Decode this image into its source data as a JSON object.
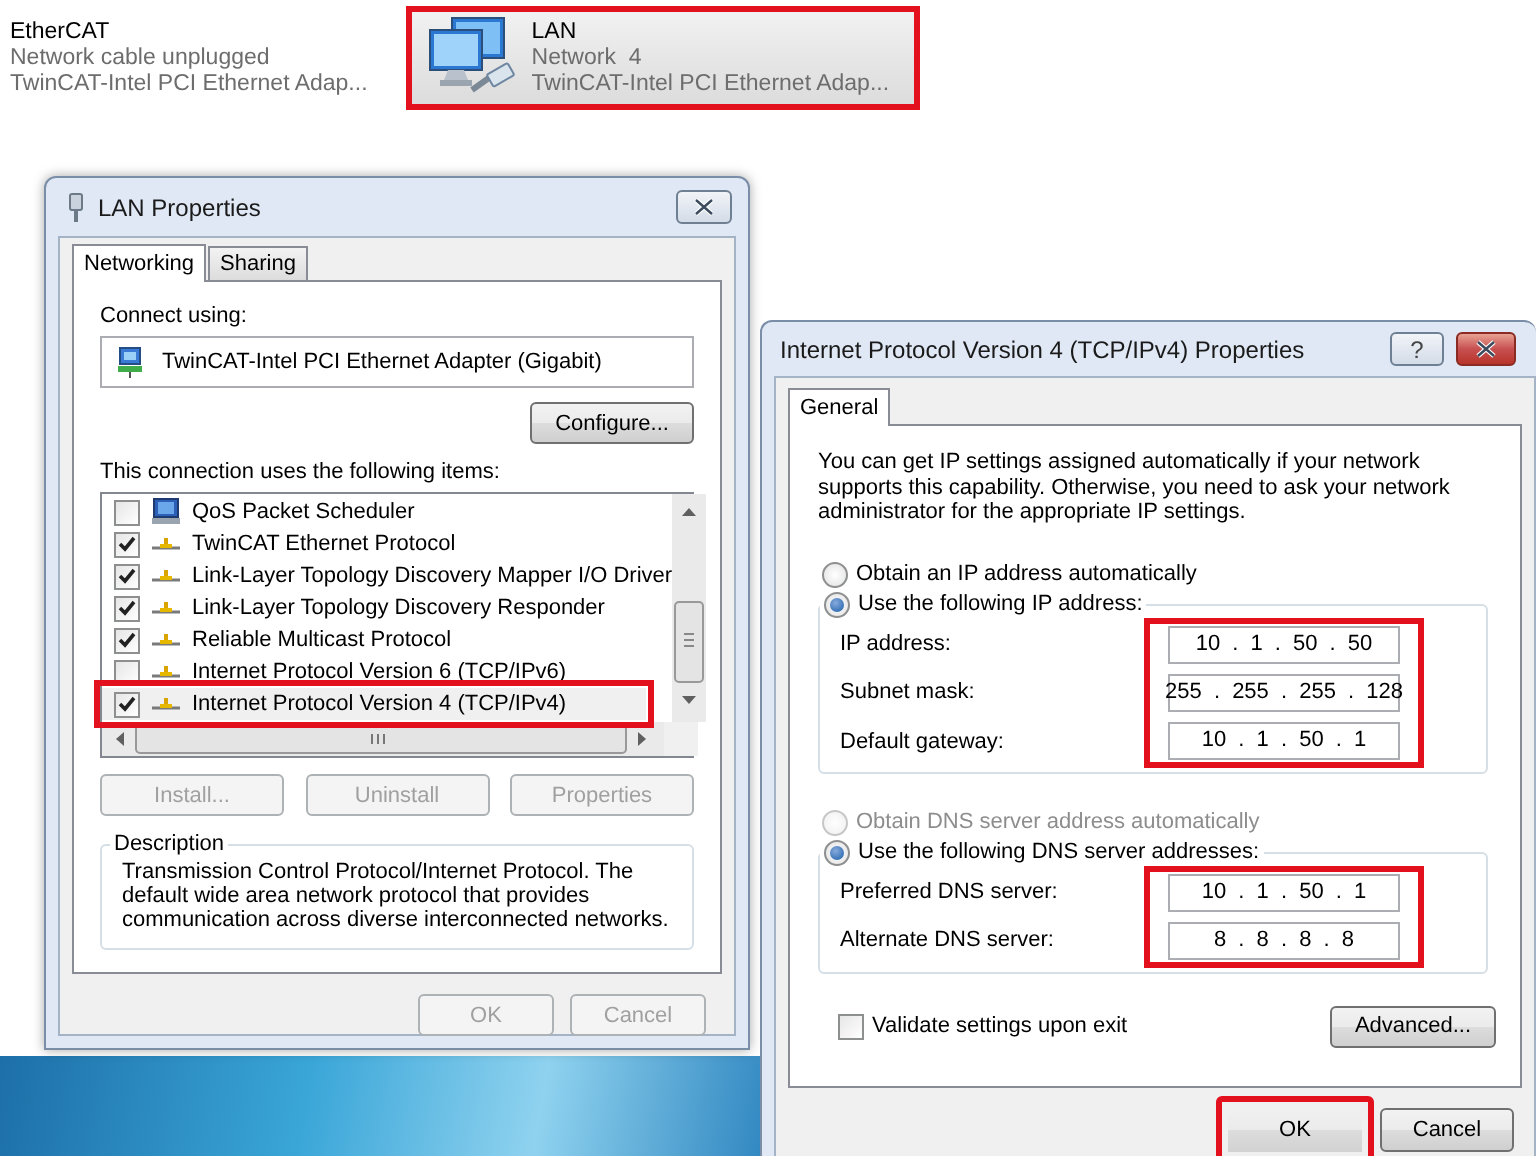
{
  "adapters": [
    {
      "name": "EtherCAT",
      "status": "Network cable unplugged",
      "device": "TwinCAT-Intel PCI Ethernet Adap...",
      "selected": false,
      "highlighted": false
    },
    {
      "name": "LAN",
      "status": "Network  4",
      "device": "TwinCAT-Intel PCI Ethernet Adap...",
      "selected": true,
      "highlighted": true
    }
  ],
  "lan_properties": {
    "title": "LAN Properties",
    "tabs": [
      {
        "label": "Networking",
        "selected": true
      },
      {
        "label": "Sharing",
        "selected": false
      }
    ],
    "connect_using_label": "Connect using:",
    "adapter": "TwinCAT-Intel PCI Ethernet Adapter (Gigabit)",
    "configure_button": "Configure...",
    "items_label": "This connection uses the following items:",
    "items": [
      {
        "kind": "service",
        "label": "QoS Packet Scheduler",
        "checked": false,
        "highlighted": false
      },
      {
        "kind": "protocol",
        "label": "TwinCAT Ethernet Protocol",
        "checked": true,
        "highlighted": false
      },
      {
        "kind": "protocol",
        "label": "Link-Layer Topology Discovery Mapper I/O Driver",
        "checked": true,
        "highlighted": false
      },
      {
        "kind": "protocol",
        "label": "Link-Layer Topology Discovery Responder",
        "checked": true,
        "highlighted": false
      },
      {
        "kind": "protocol",
        "label": "Reliable Multicast Protocol",
        "checked": true,
        "highlighted": false
      },
      {
        "kind": "protocol",
        "label": "Internet Protocol Version 6 (TCP/IPv6)",
        "checked": false,
        "highlighted": false
      },
      {
        "kind": "protocol",
        "label": "Internet Protocol Version 4 (TCP/IPv4)",
        "checked": true,
        "highlighted": true
      }
    ],
    "action_buttons": [
      {
        "label": "Install...",
        "disabled": true
      },
      {
        "label": "Uninstall",
        "disabled": true
      },
      {
        "label": "Properties",
        "disabled": true
      }
    ],
    "description_title": "Description",
    "description": "Transmission Control Protocol/Internet Protocol. The default wide area network protocol that provides communication across diverse interconnected networks.",
    "buttons": [
      {
        "label": "OK",
        "disabled": true
      },
      {
        "label": "Cancel",
        "disabled": true
      }
    ]
  },
  "ipv4_properties": {
    "title": "Internet Protocol Version 4 (TCP/IPv4) Properties",
    "help_button": "?",
    "tabs": [
      {
        "label": "General",
        "selected": true
      }
    ],
    "intro": "You can get IP settings assigned automatically if your network supports this capability. Otherwise, you need to ask your network administrator for the appropriate IP settings.",
    "ip_options": [
      {
        "label": "Obtain an IP address automatically",
        "selected": false,
        "disabled": false
      },
      {
        "label": "Use the following IP address:",
        "selected": true,
        "disabled": false
      }
    ],
    "ip_fields_highlighted": true,
    "ip_fields": [
      {
        "label": "IP address:",
        "value": "10 . 1 . 50 . 50"
      },
      {
        "label": "Subnet mask:",
        "value": "255 . 255 . 255 . 128"
      },
      {
        "label": "Default gateway:",
        "value": "10 . 1 . 50 . 1"
      }
    ],
    "dns_options": [
      {
        "label": "Obtain DNS server address automatically",
        "selected": false,
        "disabled": true
      },
      {
        "label": "Use the following DNS server addresses:",
        "selected": true,
        "disabled": false
      }
    ],
    "dns_fields_highlighted": true,
    "dns_fields": [
      {
        "label": "Preferred DNS server:",
        "value": "10 . 1 . 50 . 1"
      },
      {
        "label": "Alternate DNS server:",
        "value": "8 . 8 . 8 . 8"
      }
    ],
    "validate": {
      "label": "Validate settings upon exit",
      "checked": false
    },
    "advanced_button": "Advanced...",
    "buttons": [
      {
        "label": "OK",
        "default": true,
        "highlighted": true
      },
      {
        "label": "Cancel",
        "default": false,
        "highlighted": false
      }
    ]
  }
}
